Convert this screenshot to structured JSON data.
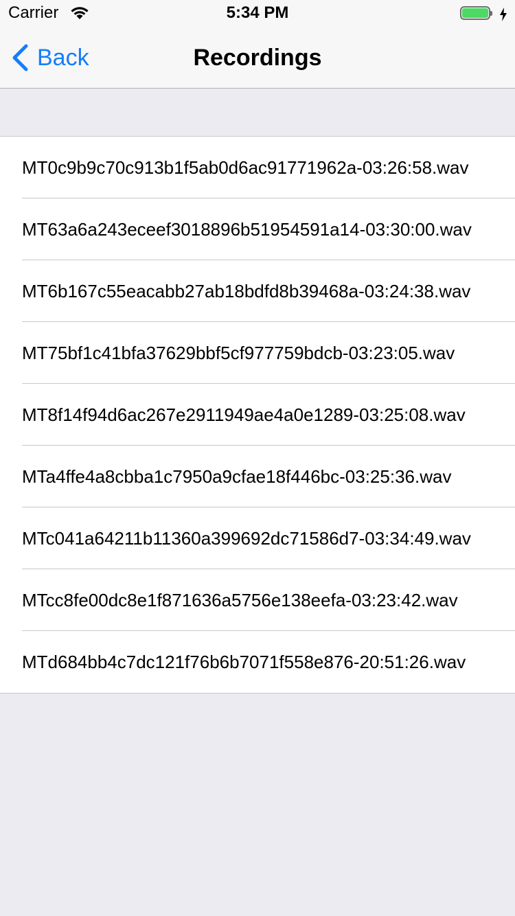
{
  "status_bar": {
    "carrier": "Carrier",
    "time": "5:34 PM",
    "battery_level": 1.0,
    "charging": true,
    "wifi_icon": "wifi-icon",
    "battery_color": "#4CD964"
  },
  "nav": {
    "back_label": "Back",
    "title": "Recordings",
    "accent": "#157EFB"
  },
  "recordings": [
    {
      "label": "MT0c9b9c70c913b1f5ab0d6ac91771962a-03:26:58.wav"
    },
    {
      "label": "MT63a6a243eceef3018896b51954591a14-03:30:00.wav"
    },
    {
      "label": "MT6b167c55eacabb27ab18bdfd8b39468a-03:24:38.wav"
    },
    {
      "label": "MT75bf1c41bfa37629bbf5cf977759bdcb-03:23:05.wav"
    },
    {
      "label": "MT8f14f94d6ac267e2911949ae4a0e1289-03:25:08.wav"
    },
    {
      "label": "MTa4ffe4a8cbba1c7950a9cfae18f446bc-03:25:36.wav"
    },
    {
      "label": "MTc041a64211b11360a399692dc71586d7-03:34:49.wav"
    },
    {
      "label": "MTcc8fe00dc8e1f871636a5756e138eefa-03:23:42.wav"
    },
    {
      "label": "MTd684bb4c7dc121f76b6b7071f558e876-20:51:26.wav"
    }
  ]
}
